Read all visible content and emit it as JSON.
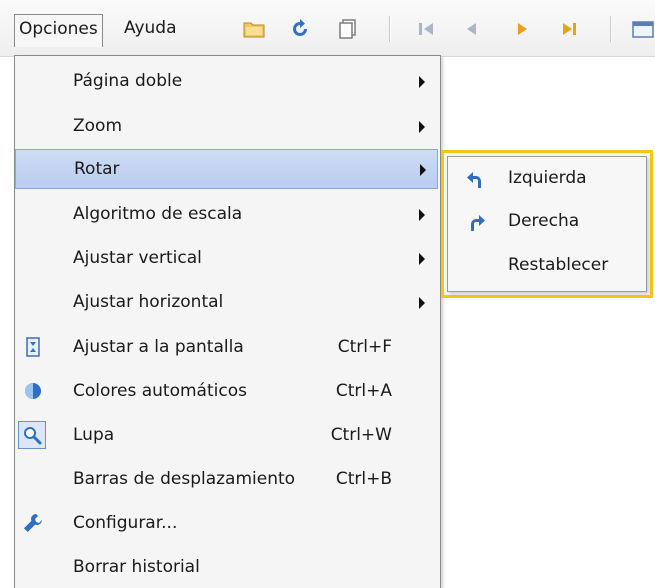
{
  "menubar": {
    "opciones": "Opciones",
    "ayuda": "Ayuda",
    "toolbar_icons": [
      "folder-icon",
      "reload-icon",
      "copy-icon",
      "first-page-icon",
      "prev-page-icon",
      "next-page-icon",
      "last-page-icon",
      "window-icon"
    ]
  },
  "menu": {
    "items": [
      {
        "label": "Página doble"
      },
      {
        "label": "Zoom"
      },
      {
        "label": "Rotar"
      },
      {
        "label": "Algoritmo de escala"
      },
      {
        "label": "Ajustar vertical"
      },
      {
        "label": "Ajustar horizontal"
      },
      {
        "label": "Ajustar a la pantalla",
        "shortcut": "Ctrl+F",
        "icon": "fit-screen-icon"
      },
      {
        "label": "Colores automáticos",
        "shortcut": "Ctrl+A",
        "icon": "auto-colors-icon"
      },
      {
        "label": "Lupa",
        "shortcut": "Ctrl+W",
        "icon": "magnifier-icon"
      },
      {
        "label": "Barras de desplazamiento",
        "shortcut": "Ctrl+B"
      },
      {
        "label": "Configurar...",
        "icon": "wrench-icon"
      },
      {
        "label": "Borrar historial"
      }
    ]
  },
  "submenu": {
    "items": [
      {
        "label": "Izquierda",
        "icon": "rotate-left-icon"
      },
      {
        "label": "Derecha",
        "icon": "rotate-right-icon"
      },
      {
        "label": "Restablecer"
      }
    ]
  },
  "colors": {
    "highlight": "#c4d5f2",
    "submenu_frame": "#f5c518",
    "menu_bg": "#f5f5f5"
  }
}
